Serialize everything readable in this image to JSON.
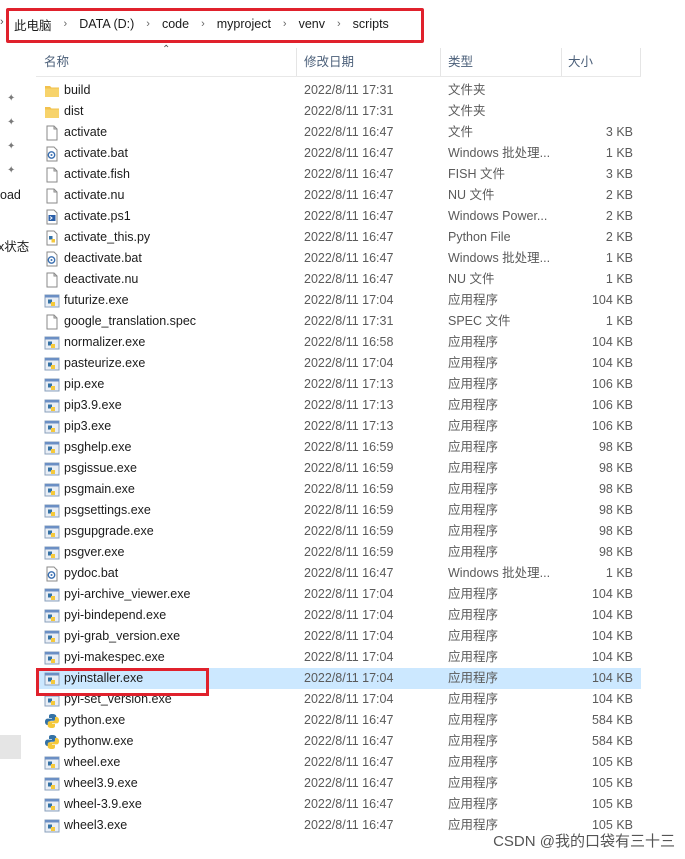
{
  "address": {
    "crumbs": [
      "此电脑",
      "DATA (D:)",
      "code",
      "myproject",
      "venv",
      "scripts"
    ]
  },
  "left_pane": {
    "partial_labels": [
      "oad",
      "x状态"
    ]
  },
  "columns": {
    "name": "名称",
    "date": "修改日期",
    "type": "类型",
    "size": "大小"
  },
  "files": [
    {
      "name": "build",
      "date": "2022/8/11 17:31",
      "type": "文件夹",
      "size": "",
      "icon": "folder-icon"
    },
    {
      "name": "dist",
      "date": "2022/8/11 17:31",
      "type": "文件夹",
      "size": "",
      "icon": "folder-icon"
    },
    {
      "name": "activate",
      "date": "2022/8/11 16:47",
      "type": "文件",
      "size": "3 KB",
      "icon": "file-icon"
    },
    {
      "name": "activate.bat",
      "date": "2022/8/11 16:47",
      "type": "Windows 批处理...",
      "size": "1 KB",
      "icon": "batch-file-icon"
    },
    {
      "name": "activate.fish",
      "date": "2022/8/11 16:47",
      "type": "FISH 文件",
      "size": "3 KB",
      "icon": "file-icon"
    },
    {
      "name": "activate.nu",
      "date": "2022/8/11 16:47",
      "type": "NU 文件",
      "size": "2 KB",
      "icon": "file-icon"
    },
    {
      "name": "activate.ps1",
      "date": "2022/8/11 16:47",
      "type": "Windows Power...",
      "size": "2 KB",
      "icon": "powershell-file-icon"
    },
    {
      "name": "activate_this.py",
      "date": "2022/8/11 16:47",
      "type": "Python File",
      "size": "2 KB",
      "icon": "python-file-icon"
    },
    {
      "name": "deactivate.bat",
      "date": "2022/8/11 16:47",
      "type": "Windows 批处理...",
      "size": "1 KB",
      "icon": "batch-file-icon"
    },
    {
      "name": "deactivate.nu",
      "date": "2022/8/11 16:47",
      "type": "NU 文件",
      "size": "1 KB",
      "icon": "file-icon"
    },
    {
      "name": "futurize.exe",
      "date": "2022/8/11 17:04",
      "type": "应用程序",
      "size": "104 KB",
      "icon": "exe-icon"
    },
    {
      "name": "google_translation.spec",
      "date": "2022/8/11 17:31",
      "type": "SPEC 文件",
      "size": "1 KB",
      "icon": "file-icon"
    },
    {
      "name": "normalizer.exe",
      "date": "2022/8/11 16:58",
      "type": "应用程序",
      "size": "104 KB",
      "icon": "exe-icon"
    },
    {
      "name": "pasteurize.exe",
      "date": "2022/8/11 17:04",
      "type": "应用程序",
      "size": "104 KB",
      "icon": "exe-icon"
    },
    {
      "name": "pip.exe",
      "date": "2022/8/11 17:13",
      "type": "应用程序",
      "size": "106 KB",
      "icon": "exe-icon"
    },
    {
      "name": "pip3.9.exe",
      "date": "2022/8/11 17:13",
      "type": "应用程序",
      "size": "106 KB",
      "icon": "exe-icon"
    },
    {
      "name": "pip3.exe",
      "date": "2022/8/11 17:13",
      "type": "应用程序",
      "size": "106 KB",
      "icon": "exe-icon"
    },
    {
      "name": "psghelp.exe",
      "date": "2022/8/11 16:59",
      "type": "应用程序",
      "size": "98 KB",
      "icon": "exe-icon"
    },
    {
      "name": "psgissue.exe",
      "date": "2022/8/11 16:59",
      "type": "应用程序",
      "size": "98 KB",
      "icon": "exe-icon"
    },
    {
      "name": "psgmain.exe",
      "date": "2022/8/11 16:59",
      "type": "应用程序",
      "size": "98 KB",
      "icon": "exe-icon"
    },
    {
      "name": "psgsettings.exe",
      "date": "2022/8/11 16:59",
      "type": "应用程序",
      "size": "98 KB",
      "icon": "exe-icon"
    },
    {
      "name": "psgupgrade.exe",
      "date": "2022/8/11 16:59",
      "type": "应用程序",
      "size": "98 KB",
      "icon": "exe-icon"
    },
    {
      "name": "psgver.exe",
      "date": "2022/8/11 16:59",
      "type": "应用程序",
      "size": "98 KB",
      "icon": "exe-icon"
    },
    {
      "name": "pydoc.bat",
      "date": "2022/8/11 16:47",
      "type": "Windows 批处理...",
      "size": "1 KB",
      "icon": "batch-file-icon"
    },
    {
      "name": "pyi-archive_viewer.exe",
      "date": "2022/8/11 17:04",
      "type": "应用程序",
      "size": "104 KB",
      "icon": "exe-icon"
    },
    {
      "name": "pyi-bindepend.exe",
      "date": "2022/8/11 17:04",
      "type": "应用程序",
      "size": "104 KB",
      "icon": "exe-icon"
    },
    {
      "name": "pyi-grab_version.exe",
      "date": "2022/8/11 17:04",
      "type": "应用程序",
      "size": "104 KB",
      "icon": "exe-icon"
    },
    {
      "name": "pyi-makespec.exe",
      "date": "2022/8/11 17:04",
      "type": "应用程序",
      "size": "104 KB",
      "icon": "exe-icon"
    },
    {
      "name": "pyinstaller.exe",
      "date": "2022/8/11 17:04",
      "type": "应用程序",
      "size": "104 KB",
      "icon": "exe-icon",
      "selected": true
    },
    {
      "name": "pyi-set_version.exe",
      "date": "2022/8/11 17:04",
      "type": "应用程序",
      "size": "104 KB",
      "icon": "exe-icon"
    },
    {
      "name": "python.exe",
      "date": "2022/8/11 16:47",
      "type": "应用程序",
      "size": "584 KB",
      "icon": "python-exe-icon"
    },
    {
      "name": "pythonw.exe",
      "date": "2022/8/11 16:47",
      "type": "应用程序",
      "size": "584 KB",
      "icon": "python-exe-icon"
    },
    {
      "name": "wheel.exe",
      "date": "2022/8/11 16:47",
      "type": "应用程序",
      "size": "105 KB",
      "icon": "exe-icon"
    },
    {
      "name": "wheel3.9.exe",
      "date": "2022/8/11 16:47",
      "type": "应用程序",
      "size": "105 KB",
      "icon": "exe-icon"
    },
    {
      "name": "wheel-3.9.exe",
      "date": "2022/8/11 16:47",
      "type": "应用程序",
      "size": "105 KB",
      "icon": "exe-icon"
    },
    {
      "name": "wheel3.exe",
      "date": "2022/8/11 16:47",
      "type": "应用程序",
      "size": "105 KB",
      "icon": "exe-icon"
    }
  ],
  "watermark": "CSDN @我的口袋有三十三",
  "colors": {
    "selection": "#cce8ff",
    "highlight_box": "#e0212c",
    "folder": "#f2c14e"
  }
}
